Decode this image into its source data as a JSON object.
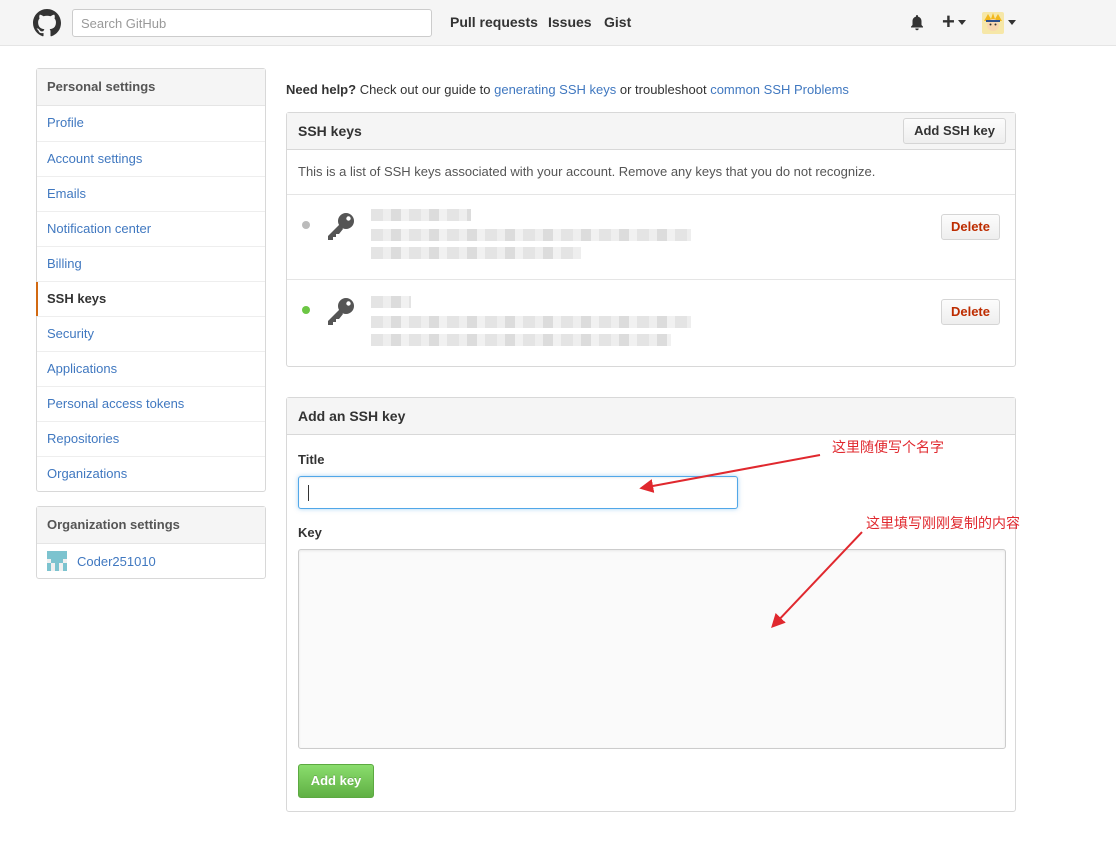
{
  "header": {
    "search_placeholder": "Search GitHub",
    "nav": [
      "Pull requests",
      "Issues",
      "Gist"
    ],
    "icons": [
      "github-logo-icon",
      "bell-icon",
      "plus-icon",
      "chevron-down-icon",
      "avatar"
    ]
  },
  "sidebar": {
    "personal_heading": "Personal settings",
    "items": [
      "Profile",
      "Account settings",
      "Emails",
      "Notification center",
      "Billing",
      "SSH keys",
      "Security",
      "Applications",
      "Personal access tokens",
      "Repositories",
      "Organizations"
    ],
    "selected": "SSH keys",
    "org_heading": "Organization settings",
    "orgs": [
      "Coder251010"
    ]
  },
  "help": {
    "lead": "Need help?",
    "text1": " Check out our guide to ",
    "link1": "generating SSH keys",
    "text2": " or troubleshoot ",
    "link2": "common SSH Problems"
  },
  "ssh_keys": {
    "title": "SSH keys",
    "add_button": "Add SSH key",
    "description": "This is a list of SSH keys associated with your account. Remove any keys that you do not recognize.",
    "delete_label": "Delete",
    "keys": [
      {
        "status": "inactive",
        "dot_color": "#bbbbbb"
      },
      {
        "status": "active",
        "dot_color": "#6cc644"
      }
    ]
  },
  "add_key": {
    "title": "Add an SSH key",
    "title_label": "Title",
    "title_value": "",
    "key_label": "Key",
    "key_value": "",
    "submit": "Add key"
  },
  "annotations": {
    "title_note": "这里随便写个名字",
    "key_note": "这里填写刚刚复制的内容",
    "color": "#e0282e"
  },
  "colors": {
    "link": "#4078c0",
    "selected_marker": "#d26911",
    "primary_button": "#60b044",
    "danger_text": "#bd2c00"
  }
}
